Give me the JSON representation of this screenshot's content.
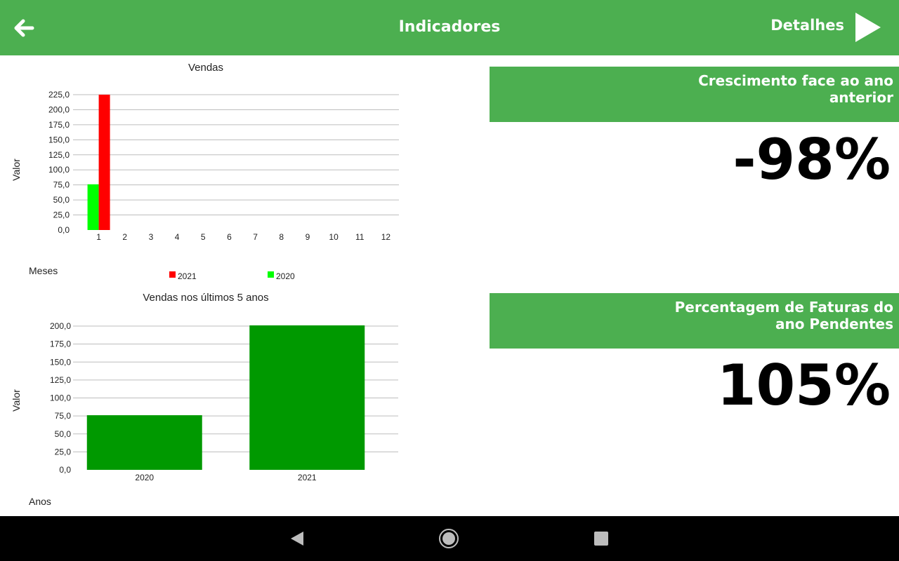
{
  "header": {
    "title": "Indicadores",
    "details_label": "Detalhes",
    "bg_color": "#4caf50"
  },
  "icons": {
    "back": "arrow-left-icon",
    "details": "play-triangle-icon",
    "nav_back": "nav-back-icon",
    "nav_home": "nav-home-icon",
    "nav_recents": "nav-recents-icon"
  },
  "kpis": [
    {
      "title": "Crescimento face ao ano anterior",
      "value": "-98%"
    },
    {
      "title": "Percentagem de Faturas do ano Pendentes",
      "value": "105%"
    }
  ],
  "chart_data": [
    {
      "type": "bar",
      "title": "Vendas",
      "ylabel": "Valor",
      "xlabel": "Meses",
      "ylim": [
        0,
        225
      ],
      "yticks": [
        "0,0",
        "25,0",
        "50,0",
        "75,0",
        "100,0",
        "125,0",
        "150,0",
        "175,0",
        "200,0",
        "225,0"
      ],
      "categories": [
        "1",
        "2",
        "3",
        "4",
        "5",
        "6",
        "7",
        "8",
        "9",
        "10",
        "11",
        "12"
      ],
      "legend": "bottom",
      "series": [
        {
          "name": "2020",
          "color": "#00ff00",
          "values": [
            76,
            0,
            0,
            0,
            0,
            0,
            0,
            0,
            0,
            0,
            0,
            0
          ]
        },
        {
          "name": "2021",
          "color": "#ff0000",
          "values": [
            225,
            0,
            0,
            0,
            0,
            0,
            0,
            0,
            0,
            0,
            0,
            0
          ]
        }
      ],
      "legend_order": [
        "2021",
        "2020"
      ]
    },
    {
      "type": "bar",
      "title": "Vendas nos últimos 5 anos",
      "ylabel": "Valor",
      "xlabel": "Anos",
      "ylim": [
        0,
        200
      ],
      "yticks": [
        "0,0",
        "25,0",
        "50,0",
        "75,0",
        "100,0",
        "125,0",
        "150,0",
        "175,0",
        "200,0"
      ],
      "categories": [
        "2020",
        "2021"
      ],
      "series": [
        {
          "name": "",
          "color": "#009900",
          "values": [
            76,
            225
          ]
        }
      ]
    }
  ]
}
